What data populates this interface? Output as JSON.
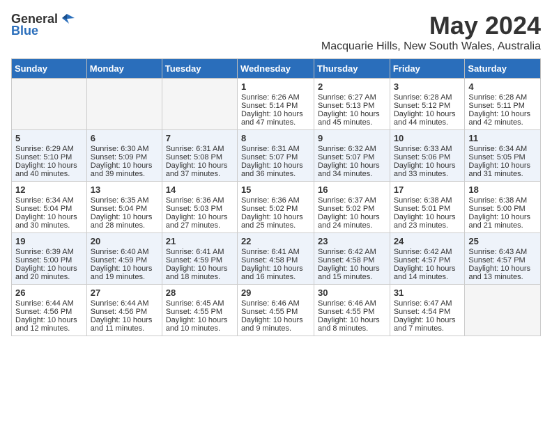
{
  "header": {
    "logo_general": "General",
    "logo_blue": "Blue",
    "title": "May 2024",
    "subtitle": "Macquarie Hills, New South Wales, Australia"
  },
  "weekdays": [
    "Sunday",
    "Monday",
    "Tuesday",
    "Wednesday",
    "Thursday",
    "Friday",
    "Saturday"
  ],
  "weeks": [
    [
      {
        "day": "",
        "info": ""
      },
      {
        "day": "",
        "info": ""
      },
      {
        "day": "",
        "info": ""
      },
      {
        "day": "1",
        "info": "Sunrise: 6:26 AM\nSunset: 5:14 PM\nDaylight: 10 hours and 47 minutes."
      },
      {
        "day": "2",
        "info": "Sunrise: 6:27 AM\nSunset: 5:13 PM\nDaylight: 10 hours and 45 minutes."
      },
      {
        "day": "3",
        "info": "Sunrise: 6:28 AM\nSunset: 5:12 PM\nDaylight: 10 hours and 44 minutes."
      },
      {
        "day": "4",
        "info": "Sunrise: 6:28 AM\nSunset: 5:11 PM\nDaylight: 10 hours and 42 minutes."
      }
    ],
    [
      {
        "day": "5",
        "info": "Sunrise: 6:29 AM\nSunset: 5:10 PM\nDaylight: 10 hours and 40 minutes."
      },
      {
        "day": "6",
        "info": "Sunrise: 6:30 AM\nSunset: 5:09 PM\nDaylight: 10 hours and 39 minutes."
      },
      {
        "day": "7",
        "info": "Sunrise: 6:31 AM\nSunset: 5:08 PM\nDaylight: 10 hours and 37 minutes."
      },
      {
        "day": "8",
        "info": "Sunrise: 6:31 AM\nSunset: 5:07 PM\nDaylight: 10 hours and 36 minutes."
      },
      {
        "day": "9",
        "info": "Sunrise: 6:32 AM\nSunset: 5:07 PM\nDaylight: 10 hours and 34 minutes."
      },
      {
        "day": "10",
        "info": "Sunrise: 6:33 AM\nSunset: 5:06 PM\nDaylight: 10 hours and 33 minutes."
      },
      {
        "day": "11",
        "info": "Sunrise: 6:34 AM\nSunset: 5:05 PM\nDaylight: 10 hours and 31 minutes."
      }
    ],
    [
      {
        "day": "12",
        "info": "Sunrise: 6:34 AM\nSunset: 5:04 PM\nDaylight: 10 hours and 30 minutes."
      },
      {
        "day": "13",
        "info": "Sunrise: 6:35 AM\nSunset: 5:04 PM\nDaylight: 10 hours and 28 minutes."
      },
      {
        "day": "14",
        "info": "Sunrise: 6:36 AM\nSunset: 5:03 PM\nDaylight: 10 hours and 27 minutes."
      },
      {
        "day": "15",
        "info": "Sunrise: 6:36 AM\nSunset: 5:02 PM\nDaylight: 10 hours and 25 minutes."
      },
      {
        "day": "16",
        "info": "Sunrise: 6:37 AM\nSunset: 5:02 PM\nDaylight: 10 hours and 24 minutes."
      },
      {
        "day": "17",
        "info": "Sunrise: 6:38 AM\nSunset: 5:01 PM\nDaylight: 10 hours and 23 minutes."
      },
      {
        "day": "18",
        "info": "Sunrise: 6:38 AM\nSunset: 5:00 PM\nDaylight: 10 hours and 21 minutes."
      }
    ],
    [
      {
        "day": "19",
        "info": "Sunrise: 6:39 AM\nSunset: 5:00 PM\nDaylight: 10 hours and 20 minutes."
      },
      {
        "day": "20",
        "info": "Sunrise: 6:40 AM\nSunset: 4:59 PM\nDaylight: 10 hours and 19 minutes."
      },
      {
        "day": "21",
        "info": "Sunrise: 6:41 AM\nSunset: 4:59 PM\nDaylight: 10 hours and 18 minutes."
      },
      {
        "day": "22",
        "info": "Sunrise: 6:41 AM\nSunset: 4:58 PM\nDaylight: 10 hours and 16 minutes."
      },
      {
        "day": "23",
        "info": "Sunrise: 6:42 AM\nSunset: 4:58 PM\nDaylight: 10 hours and 15 minutes."
      },
      {
        "day": "24",
        "info": "Sunrise: 6:42 AM\nSunset: 4:57 PM\nDaylight: 10 hours and 14 minutes."
      },
      {
        "day": "25",
        "info": "Sunrise: 6:43 AM\nSunset: 4:57 PM\nDaylight: 10 hours and 13 minutes."
      }
    ],
    [
      {
        "day": "26",
        "info": "Sunrise: 6:44 AM\nSunset: 4:56 PM\nDaylight: 10 hours and 12 minutes."
      },
      {
        "day": "27",
        "info": "Sunrise: 6:44 AM\nSunset: 4:56 PM\nDaylight: 10 hours and 11 minutes."
      },
      {
        "day": "28",
        "info": "Sunrise: 6:45 AM\nSunset: 4:55 PM\nDaylight: 10 hours and 10 minutes."
      },
      {
        "day": "29",
        "info": "Sunrise: 6:46 AM\nSunset: 4:55 PM\nDaylight: 10 hours and 9 minutes."
      },
      {
        "day": "30",
        "info": "Sunrise: 6:46 AM\nSunset: 4:55 PM\nDaylight: 10 hours and 8 minutes."
      },
      {
        "day": "31",
        "info": "Sunrise: 6:47 AM\nSunset: 4:54 PM\nDaylight: 10 hours and 7 minutes."
      },
      {
        "day": "",
        "info": ""
      }
    ]
  ]
}
